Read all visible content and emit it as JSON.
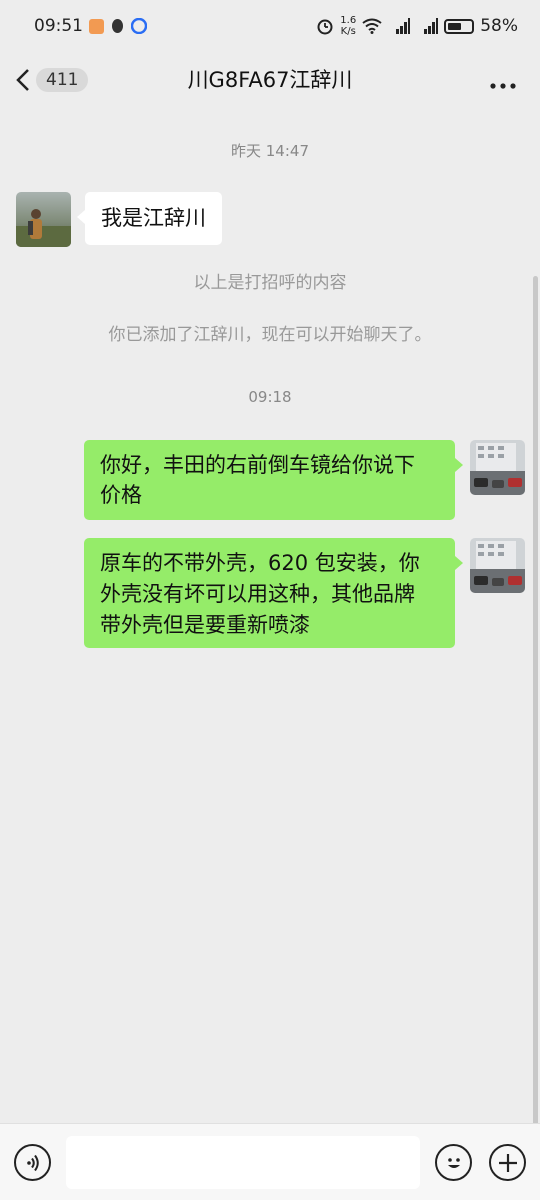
{
  "status_bar": {
    "time": "09:51",
    "net_speed_value": "1.6",
    "net_speed_unit": "K/s",
    "battery_percent": "58%",
    "battery_level": 0.58
  },
  "nav": {
    "unread_count": "411",
    "title": "川G8FA67江辞川",
    "more_icon": "more-icon"
  },
  "chat": {
    "time_1": "昨天 14:47",
    "incoming_1": "我是江辞川",
    "system_1": "以上是打招呼的内容",
    "system_2": "你已添加了江辞川，现在可以开始聊天了。",
    "time_2": "09:18",
    "outgoing_1_line1": "你好，丰田的右前倒车镜给你说下",
    "outgoing_1_line2": "价格",
    "outgoing_2_line1": "原车的不带外壳，620 包安装，你",
    "outgoing_2_line2": "外壳没有坏可以用这种，其他品牌",
    "outgoing_2_line3": "带外壳但是要重新喷漆"
  },
  "colors": {
    "background": "#ededed",
    "outgoing_bubble": "#95ec69",
    "incoming_bubble": "#ffffff"
  }
}
